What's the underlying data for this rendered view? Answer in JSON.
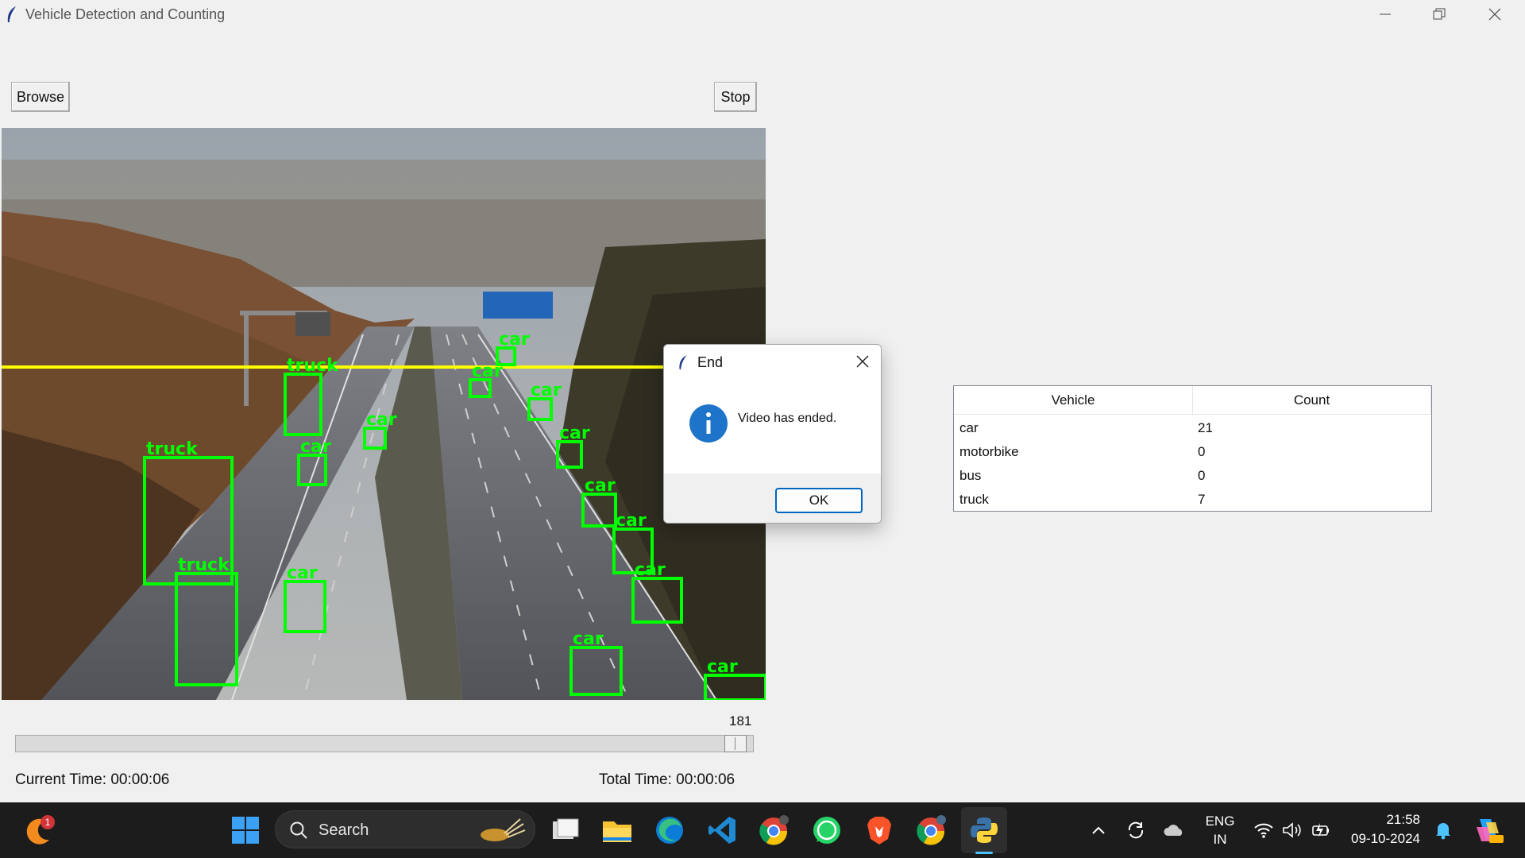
{
  "window": {
    "title": "Vehicle Detection and Counting"
  },
  "toolbar": {
    "browse_label": "Browse",
    "stop_label": "Stop"
  },
  "video": {
    "detections": [
      {
        "label": "car"
      },
      {
        "label": "car"
      },
      {
        "label": "car"
      },
      {
        "label": "truck"
      },
      {
        "label": "car"
      },
      {
        "label": "car"
      },
      {
        "label": "truck"
      },
      {
        "label": "car"
      },
      {
        "label": "car"
      },
      {
        "label": "truck"
      },
      {
        "label": "car"
      },
      {
        "label": "car"
      },
      {
        "label": "car"
      },
      {
        "label": "car"
      },
      {
        "label": "car"
      }
    ],
    "box_color": "#00ff00",
    "line_color": "#ffff00"
  },
  "slider": {
    "value": "181",
    "fraction": 0.99
  },
  "times": {
    "current": "Current Time: 00:00:06",
    "total": "Total Time: 00:00:06"
  },
  "table": {
    "headers": [
      "Vehicle",
      "Count"
    ],
    "rows": [
      {
        "vehicle": "car",
        "count": "21"
      },
      {
        "vehicle": "motorbike",
        "count": "0"
      },
      {
        "vehicle": "bus",
        "count": "0"
      },
      {
        "vehicle": "truck",
        "count": "7"
      }
    ]
  },
  "dialog": {
    "title": "End",
    "message": "Video has ended.",
    "ok_label": "OK"
  },
  "taskbar": {
    "search_label": "Search",
    "notification_badge": "1",
    "lang_line1": "ENG",
    "lang_line2": "IN",
    "time": "21:58",
    "date": "09-10-2024",
    "icons": [
      "start-icon",
      "search-icon",
      "task-view-icon",
      "file-explorer-icon",
      "edge-icon",
      "vscode-icon",
      "chrome-icon",
      "whatsapp-icon",
      "brave-icon",
      "chrome-profile-icon",
      "python-icon"
    ]
  }
}
